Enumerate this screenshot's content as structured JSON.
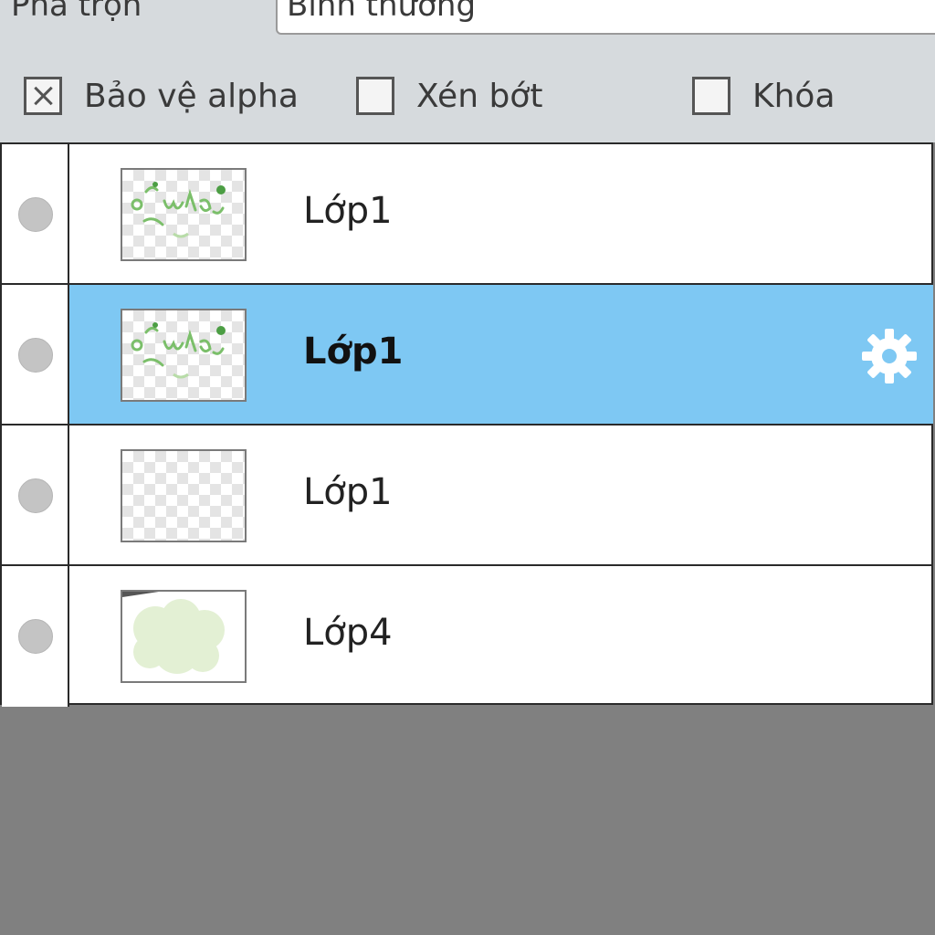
{
  "blend": {
    "label": "Pha trộn",
    "value": "Bình thường"
  },
  "options": [
    {
      "label": "Bảo vệ alpha",
      "checked": true
    },
    {
      "label": "Xén bớt",
      "checked": false
    },
    {
      "label": "Khóa",
      "checked": false
    }
  ],
  "layers": [
    {
      "name": "Lớp1",
      "selected": false,
      "thumbnail": "green-text-sketch"
    },
    {
      "name": "Lớp1",
      "selected": true,
      "thumbnail": "green-text-sketch",
      "settings_icon": "gear-icon"
    },
    {
      "name": "Lớp1",
      "selected": false,
      "thumbnail": "empty-transparent"
    },
    {
      "name": "Lớp4",
      "selected": false,
      "thumbnail": "light-green-blob"
    }
  ],
  "colors": {
    "selected_row": "#7ec8f3",
    "panel_background": "#d6dadd",
    "canvas_background": "#808080"
  }
}
